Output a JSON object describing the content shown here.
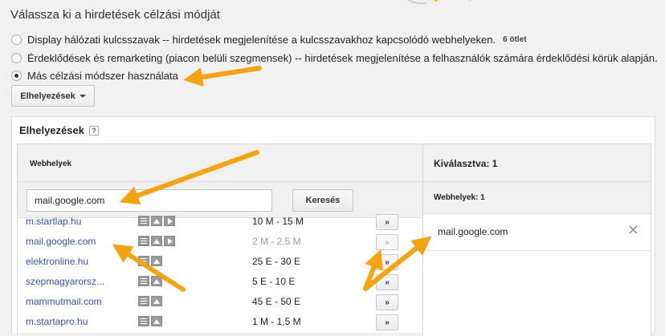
{
  "heading": "Válassza ki a hirdetések célzási módját",
  "targeting_options": [
    {
      "label": "Display hálózati kulcsszavak -- hirdetések megjelenítése a kulcsszavakhoz kapcsolódó webhelyeken.",
      "badge": "6 ötlet",
      "selected": false
    },
    {
      "label": "Érdeklődések és remarketing (piacon belüli szegmensek) -- hirdetések megjelenítése a felhasználók számára érdeklődési körük alapján.",
      "badge": "",
      "selected": false
    },
    {
      "label": "Más célzási módszer használata",
      "badge": "",
      "selected": true
    }
  ],
  "dropdown": {
    "label": "Elhelyezések"
  },
  "panel": {
    "title": "Elhelyezések",
    "help_glyph": "?",
    "left": {
      "header": "Webhelyek",
      "search_value": "mail.google.com",
      "search_button": "Keresés",
      "add_glyph": "»",
      "rows": [
        {
          "name": "m.startlap.hu",
          "icons": [
            "text",
            "image",
            "video"
          ],
          "reach": "10 M - 15 M",
          "dim": false,
          "added": false
        },
        {
          "name": "mail.google.com",
          "icons": [
            "text",
            "image",
            "video"
          ],
          "reach": "2 M - 2,5 M",
          "dim": true,
          "added": true
        },
        {
          "name": "elektronline.hu",
          "icons": [
            "text",
            "image"
          ],
          "reach": "25 E - 30 E",
          "dim": false,
          "added": false
        },
        {
          "name": "szepmagyarorsz...",
          "icons": [
            "text",
            "image"
          ],
          "reach": "5 E - 10 E",
          "dim": false,
          "added": false
        },
        {
          "name": "mammutmail.com",
          "icons": [
            "text",
            "image"
          ],
          "reach": "45 E - 50 E",
          "dim": false,
          "added": false
        },
        {
          "name": "m.startapro.hu",
          "icons": [
            "text",
            "image"
          ],
          "reach": "1 M - 1,5 M",
          "dim": false,
          "added": false
        }
      ]
    },
    "right": {
      "header": "Kiválasztva: 1",
      "subheader": "Webhelyek: 1",
      "items": [
        {
          "label": "mail.google.com",
          "remove_glyph": "✕"
        }
      ]
    }
  },
  "colors": {
    "link": "#3552b5",
    "arrow": "#f5a30f",
    "background": "#f1f1f1"
  }
}
